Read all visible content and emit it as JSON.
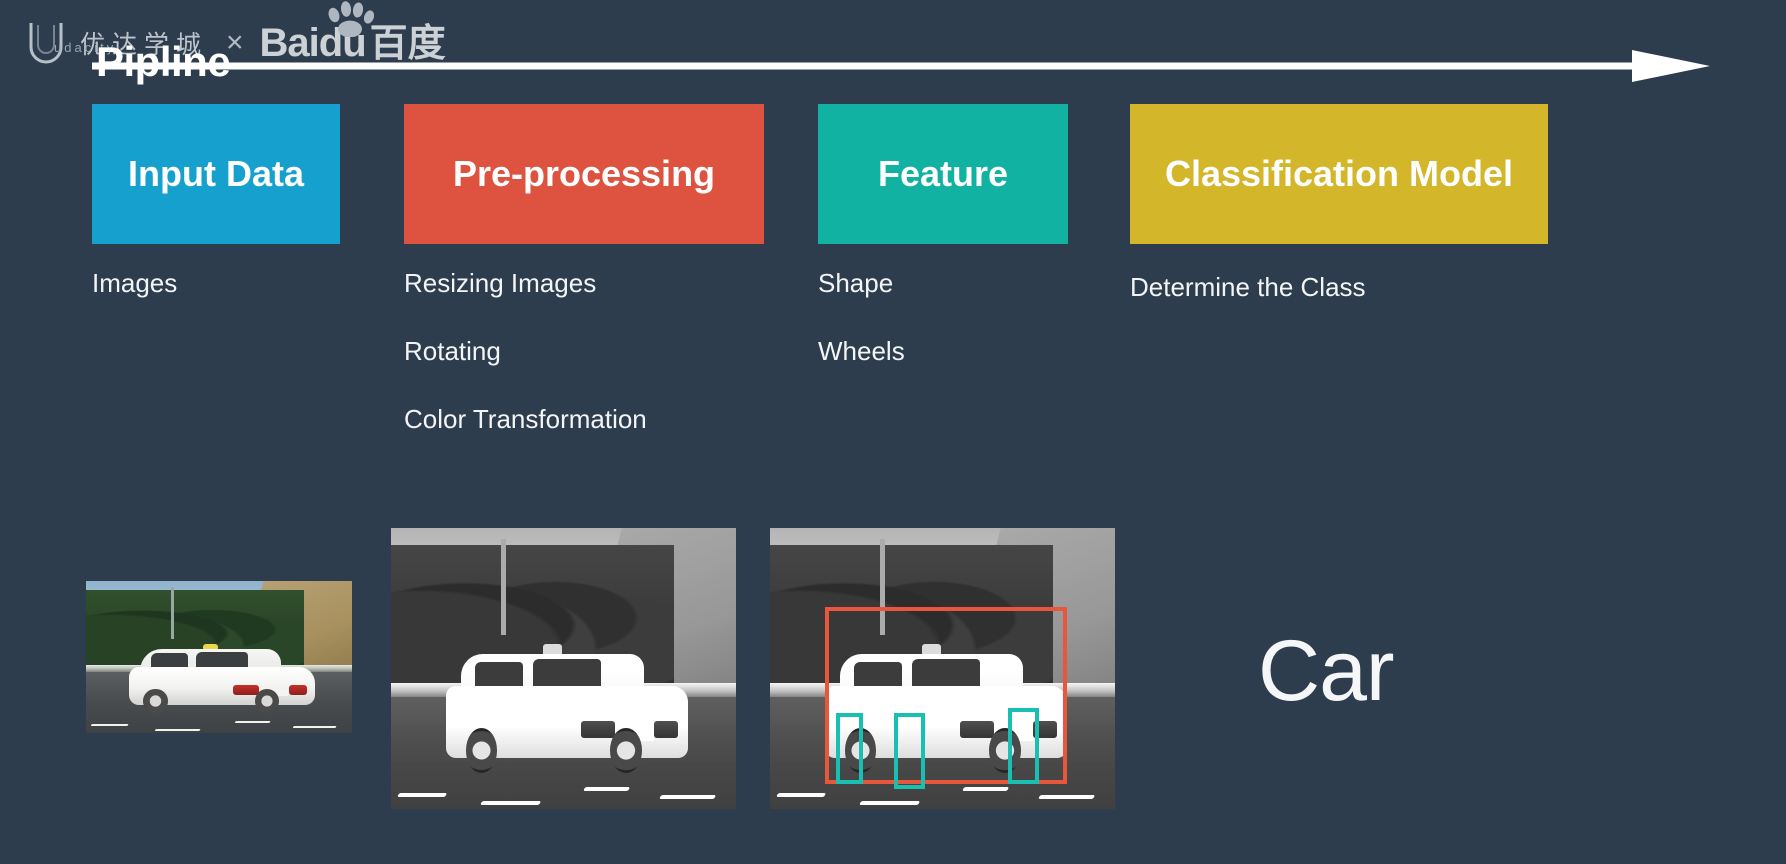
{
  "background_color": "#2e3d4d",
  "branding": {
    "udacity_cn": "优达学城",
    "udacity_latin": "udacity",
    "partner_separator": "×",
    "baidu_latin": "Baidu",
    "baidu_cn": "百度",
    "udacity_icon": "udacity-u-logo",
    "baidu_icon": "baidu-paw-logo"
  },
  "title": "Pipline",
  "flow_arrow": {
    "icon": "right-arrow-icon",
    "color": "#ffffff",
    "direction": "left-to-right"
  },
  "stages": [
    {
      "label": "Input Data",
      "color": "#16a0ce",
      "items": [
        "Images"
      ]
    },
    {
      "label": "Pre-processing",
      "color": "#dd5340",
      "items": [
        "Resizing Images",
        "Rotating",
        "Color Transformation"
      ]
    },
    {
      "label": "Feature",
      "color": "#12b2a2",
      "items": [
        "Shape",
        "Wheels"
      ]
    },
    {
      "label": "Classification Model",
      "color": "#d4b62a",
      "items": [
        "Determine the Class"
      ]
    }
  ],
  "examples": [
    {
      "name": "input-photo-color",
      "caption": "color photo of white sedan on highway",
      "mode": "color",
      "overlays": []
    },
    {
      "name": "preprocessed-photo-grayscale",
      "caption": "grayscale enlarged photo of white sedan on highway",
      "mode": "grayscale",
      "overlays": []
    },
    {
      "name": "feature-detection-photo",
      "caption": "grayscale photo with detection boxes",
      "mode": "grayscale",
      "overlays": [
        {
          "name": "car-bounding-box",
          "color": "#e8563c",
          "target": "car"
        },
        {
          "name": "wheel-box-1",
          "color": "#19bfb0",
          "target": "wheel"
        },
        {
          "name": "wheel-box-2",
          "color": "#19bfb0",
          "target": "wheel"
        },
        {
          "name": "wheel-box-3",
          "color": "#19bfb0",
          "target": "wheel"
        }
      ]
    }
  ],
  "result": {
    "label": "Car"
  }
}
